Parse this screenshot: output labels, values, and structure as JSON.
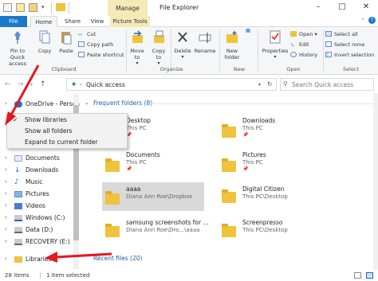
{
  "title": {
    "manage": "Manage",
    "app": "File Explorer"
  },
  "tabs": [
    "File",
    "Home",
    "Share",
    "View",
    "Picture Tools"
  ],
  "ribbon": {
    "clipboard": {
      "pin": "Pin to Quick access",
      "copy": "Copy",
      "paste": "Paste",
      "cut": "Cut",
      "copy_path": "Copy path",
      "paste_shortcut": "Paste shortcut",
      "label": "Clipboard"
    },
    "organize": {
      "move_to": "Move to",
      "copy_to": "Copy to",
      "delete": "Delete",
      "rename": "Rename",
      "label": "Organize"
    },
    "new": {
      "new_folder": "New folder",
      "label": "New"
    },
    "open": {
      "properties": "Properties",
      "open": "Open",
      "edit": "Edit",
      "history": "History",
      "label": "Open"
    },
    "select": {
      "select_all": "Select all",
      "select_none": "Select none",
      "invert": "Invert selection",
      "label": "Select"
    }
  },
  "address": {
    "path": "Quick access",
    "search_placeholder": "Search Quick access"
  },
  "nav": {
    "onedrive": "OneDrive - Person",
    "items": [
      "Documents",
      "Downloads",
      "Music",
      "Pictures",
      "Videos",
      "Windows (C:)",
      "Data (D:)",
      "RECOVERY (E:)",
      "Libraries"
    ]
  },
  "context_menu": [
    "Show libraries",
    "Show all folders",
    "Expand to current folder"
  ],
  "content": {
    "frequent_header": "Frequent folders (8)",
    "recent_header": "Recent files (20)",
    "folders": [
      {
        "name": "Desktop",
        "sub": "This PC"
      },
      {
        "name": "Downloads",
        "sub": "This PC"
      },
      {
        "name": "Documents",
        "sub": "This PC"
      },
      {
        "name": "Pictures",
        "sub": "This PC"
      },
      {
        "name": "aaaa",
        "sub": "Diana Ann Roe\\Dropbox"
      },
      {
        "name": "Digital Citizen",
        "sub": "This PC\\Desktop"
      },
      {
        "name": "samsung screenshots for ...",
        "sub": "Diana Ann Roe\\Dro...\\aaaa"
      },
      {
        "name": "Screenpresso",
        "sub": "This PC\\Desktop"
      }
    ]
  },
  "status": {
    "count": "28 items",
    "selected": "1 item selected"
  },
  "colors": {
    "accent": "#1979ca",
    "manage": "#f6e9b8",
    "arrow": "#e5181d",
    "folder": "#f0c33c"
  }
}
